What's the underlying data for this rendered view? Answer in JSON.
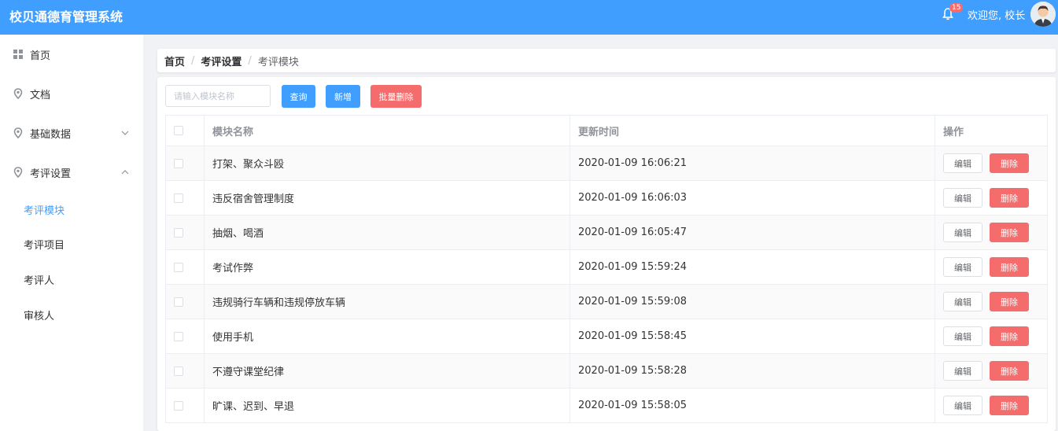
{
  "header": {
    "title": "校贝通德育管理系统",
    "notification_count": "15",
    "welcome": "欢迎您, 校长",
    "accent": "#409eff"
  },
  "sidebar": {
    "items": [
      {
        "label": "首页",
        "icon": "grid-icon"
      },
      {
        "label": "文档",
        "icon": "location-icon"
      },
      {
        "label": "基础数据",
        "icon": "location-icon",
        "arrow": "chevron-down-icon"
      },
      {
        "label": "考评设置",
        "icon": "location-icon",
        "arrow": "chevron-up-icon"
      }
    ],
    "sub_items": [
      {
        "label": "考评模块",
        "active": true
      },
      {
        "label": "考评项目"
      },
      {
        "label": "考评人"
      },
      {
        "label": "审核人"
      }
    ]
  },
  "breadcrumb": {
    "home": "首页",
    "parent": "考评设置",
    "current": "考评模块"
  },
  "toolbar": {
    "search_placeholder": "请输入模块名称",
    "query_label": "查询",
    "add_label": "新增",
    "batch_delete_label": "批量删除",
    "danger_color": "#f56c6c"
  },
  "table": {
    "columns": [
      "模块名称",
      "更新时间",
      "操作"
    ],
    "rows": [
      {
        "name": "打架、聚众斗殴",
        "time": "2020-01-09 16:06:21"
      },
      {
        "name": "违反宿舍管理制度",
        "time": "2020-01-09 16:06:03"
      },
      {
        "name": "抽烟、喝酒",
        "time": "2020-01-09 16:05:47"
      },
      {
        "name": "考试作弊",
        "time": "2020-01-09 15:59:24"
      },
      {
        "name": "违规骑行车辆和违规停放车辆",
        "time": "2020-01-09 15:59:08"
      },
      {
        "name": "使用手机",
        "time": "2020-01-09 15:58:45"
      },
      {
        "name": "不遵守课堂纪律",
        "time": "2020-01-09 15:58:28"
      },
      {
        "name": "旷课、迟到、早退",
        "time": "2020-01-09 15:58:05"
      }
    ],
    "edit_label": "编辑",
    "delete_label": "删除"
  }
}
